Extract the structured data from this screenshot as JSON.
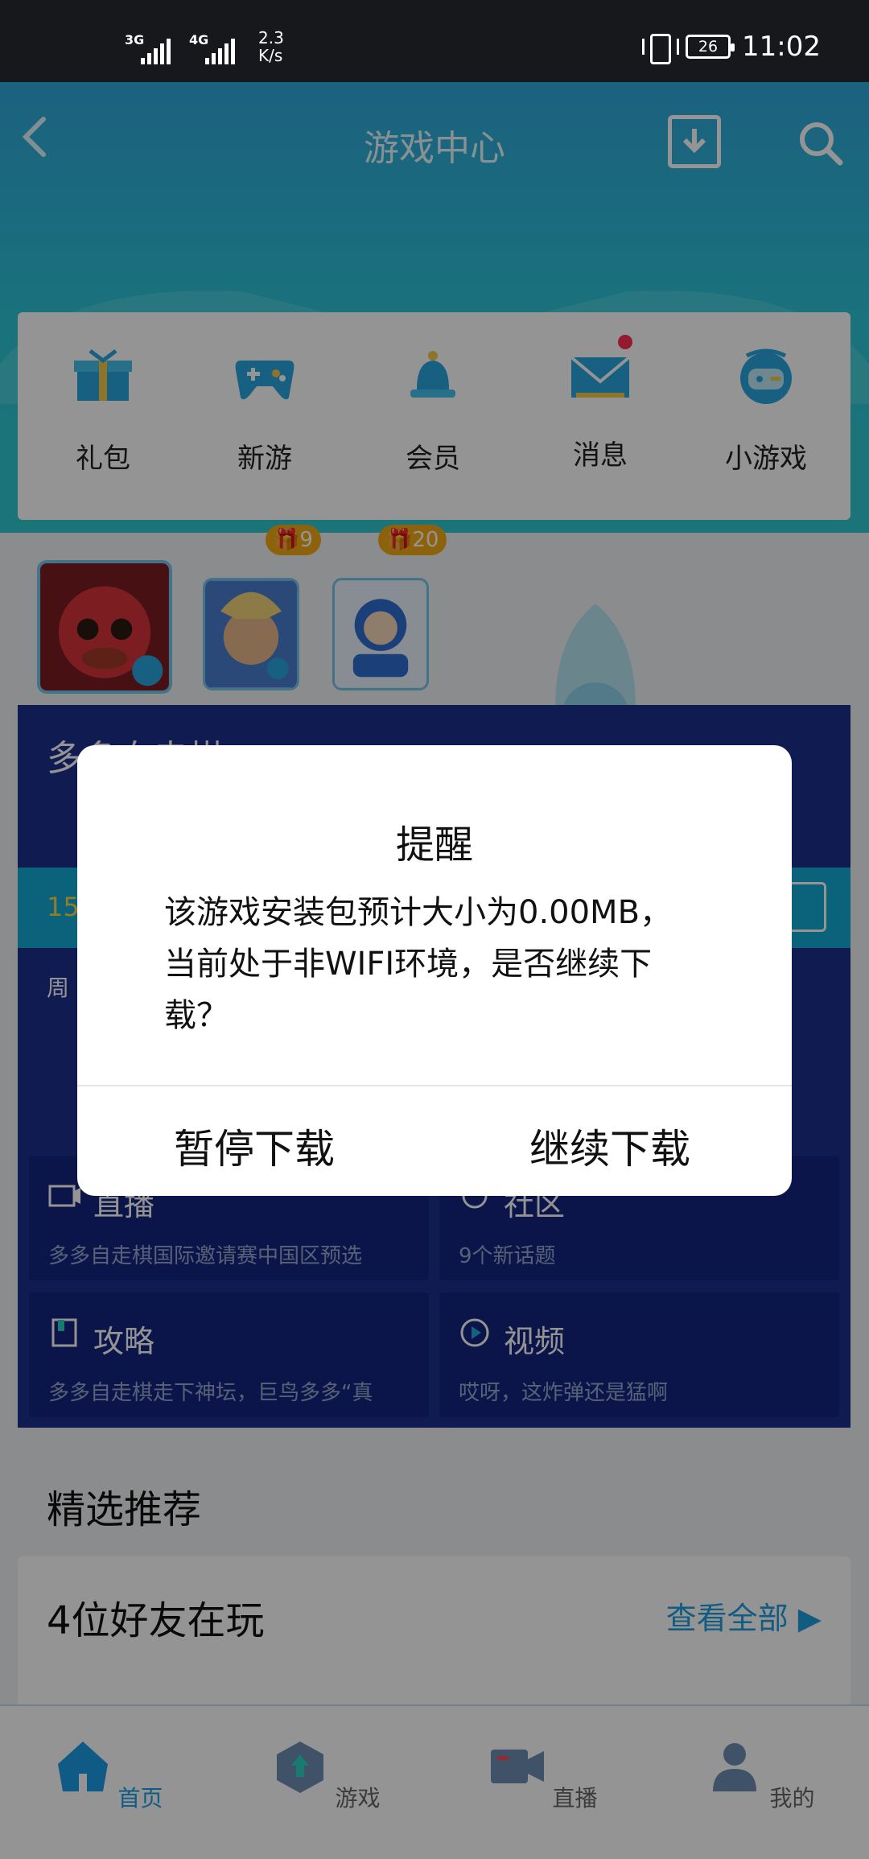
{
  "status_bar": {
    "signal1_gen": "3G",
    "signal2_gen": "4G",
    "net_speed_value": "2.3",
    "net_speed_unit": "K/s",
    "battery": "26",
    "time": "11:02"
  },
  "header": {
    "title": "游戏中心",
    "back_icon": "chevron-left-icon",
    "download_icon": "download-box-icon",
    "search_icon": "search-icon"
  },
  "quick_links": [
    {
      "label": "礼包",
      "icon": "gift-icon"
    },
    {
      "label": "新游",
      "icon": "gamepad-icon"
    },
    {
      "label": "会员",
      "icon": "bell-icon"
    },
    {
      "label": "消息",
      "icon": "envelope-icon",
      "has_dot": true
    },
    {
      "label": "小游戏",
      "icon": "mini-game-icon"
    }
  ],
  "games": [
    {
      "name": "game-1"
    },
    {
      "badge": "9"
    },
    {
      "badge": "20"
    }
  ],
  "panel": {
    "title": "多多自走棋",
    "strip_text": "15",
    "week_text": "周",
    "cells": [
      {
        "title": "直播",
        "sub": "多多自走棋国际邀请赛中国区预选",
        "icon": "tv-icon"
      },
      {
        "title": "社区",
        "sub": "9个新话题",
        "icon": "community-icon"
      },
      {
        "title": "攻略",
        "sub": "多多自走棋走下神坛，巨鸟多多“真",
        "icon": "book-icon"
      },
      {
        "title": "视频",
        "sub": "哎呀，这炸弹还是猛啊",
        "icon": "video-icon"
      }
    ]
  },
  "recommend": {
    "title": "精选推荐",
    "friends_title": "4位好友在玩",
    "view_all": "查看全部"
  },
  "bottom_nav": [
    {
      "label": "首页",
      "icon": "home-icon",
      "active": true
    },
    {
      "label": "游戏",
      "icon": "game-icon"
    },
    {
      "label": "直播",
      "icon": "camera-icon"
    },
    {
      "label": "我的",
      "icon": "user-icon"
    }
  ],
  "dialog": {
    "title": "提醒",
    "body": "该游戏安装包预计大小为0.00MB，当前处于非WIFI环境，是否继续下载？",
    "pause_label": "暂停下载",
    "continue_label": "继续下载"
  },
  "colors": {
    "accent": "#1b9ee6",
    "header_top": "#2fa8dc",
    "panel": "#1c2f8e",
    "badge": "#f3a915"
  }
}
